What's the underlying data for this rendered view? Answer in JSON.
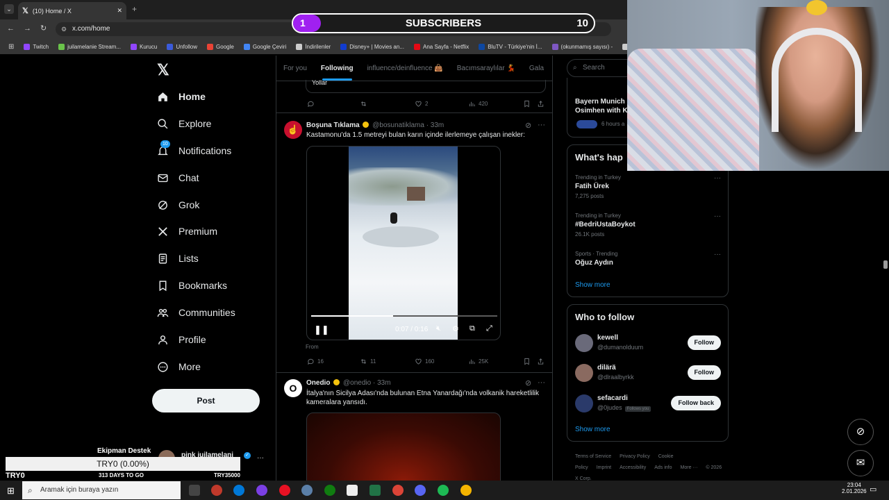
{
  "browser": {
    "tab_title": "(10) Home / X",
    "url": "x.com/home",
    "bookmarks": [
      {
        "label": "Twitch",
        "color": "#9146ff"
      },
      {
        "label": "juilamelanie Stream...",
        "color": "#6ac34a"
      },
      {
        "label": "Kurucu",
        "color": "#9146ff"
      },
      {
        "label": "Unfollow",
        "color": "#3b5bdb"
      },
      {
        "label": "Google",
        "color": "#ea4335"
      },
      {
        "label": "Google Çeviri",
        "color": "#4285f4"
      },
      {
        "label": "İndirilenler",
        "color": "#cccccc"
      },
      {
        "label": "Disney+ | Movies an...",
        "color": "#113ccf"
      },
      {
        "label": "Ana Sayfa - Netflix",
        "color": "#e50914"
      },
      {
        "label": "BluTV - Türkiye'nin İ...",
        "color": "#0d47a1"
      },
      {
        "label": "(okunmamış sayısı) -",
        "color": "#7e57c2"
      },
      {
        "label": "ju",
        "color": "#cccccc"
      }
    ]
  },
  "overlay": {
    "sub_count_left": "1",
    "sub_title": "SUBSCRIBERS",
    "sub_count_right": "10",
    "donation_name": "Ekipman Destek",
    "donation_progress": "TRY0 (0.00%)",
    "donation_progress_fraction": 0,
    "donation_start": "TRY0",
    "donation_days": "313 DAYS TO GO",
    "donation_goal": "TRY35000"
  },
  "nav": {
    "items": [
      {
        "label": "Home",
        "icon": "home-icon"
      },
      {
        "label": "Explore",
        "icon": "search-icon"
      },
      {
        "label": "Notifications",
        "icon": "bell-icon",
        "badge": "10"
      },
      {
        "label": "Chat",
        "icon": "mail-icon"
      },
      {
        "label": "Grok",
        "icon": "grok-icon"
      },
      {
        "label": "Premium",
        "icon": "x-icon"
      },
      {
        "label": "Lists",
        "icon": "list-icon"
      },
      {
        "label": "Bookmarks",
        "icon": "bookmark-icon"
      },
      {
        "label": "Communities",
        "icon": "people-icon"
      },
      {
        "label": "Profile",
        "icon": "person-icon"
      },
      {
        "label": "More",
        "icon": "more-icon"
      }
    ],
    "post_label": "Post",
    "account_name": "pink juilamelani",
    "account_more": "···"
  },
  "feed": {
    "tabs": [
      "For you",
      "Following",
      "influence/deinfluence 👜",
      "Bacımsaraylılar 💃",
      "Gala"
    ],
    "active_tab": "Following",
    "prev_tweet": {
      "tail_text": "Yollar",
      "replies": "",
      "likes": "2",
      "views": "420"
    },
    "tweet1": {
      "name": "Boşuna Tıklama",
      "handle": "@bosunatiklama",
      "time": "· 33m",
      "text": "Kastamonu'da 1.5 metreyi bulan karın içinde ilerlemeye çalışan inekler:",
      "video_time": "0:07 / 0:16",
      "video_progress_fraction": 0.44,
      "from_label": "From",
      "replies": "16",
      "reposts": "11",
      "likes": "160",
      "views": "25K"
    },
    "tweet2": {
      "name": "Onedio",
      "handle": "@onedio",
      "time": "· 33m",
      "text": "İtalya'nın Sicilya Adası'nda bulunan Etna Yanardağı'nda volkanik hareketlilik kameralara yansıdı."
    }
  },
  "sidebar": {
    "search_placeholder": "Search",
    "news_title": "Bayern Munich",
    "news_title2": "Osimhen with K",
    "news_time": "6 hours a",
    "whats_happening": "What's hap",
    "trends": [
      {
        "context": "Trending in Turkey",
        "name": "Fatih Ürek",
        "posts": "7,275 posts"
      },
      {
        "context": "Trending in Turkey",
        "name": "#BedriUstaBoykot",
        "posts": "26.1K posts"
      },
      {
        "context": "Sports · Trending",
        "name": "Oğuz Aydın",
        "posts": ""
      }
    ],
    "show_more": "Show more",
    "who_to_follow": "Who to follow",
    "follow_suggestions": [
      {
        "name": "kewell",
        "handle": "@dumanolduum",
        "button": "Follow",
        "follows_you": ""
      },
      {
        "name": "dilärä",
        "handle": "@dlraalbyrkk",
        "button": "Follow",
        "follows_you": ""
      },
      {
        "name": "sefacardi",
        "handle": "@0judes",
        "button": "Follow back",
        "follows_you": "Follows you"
      }
    ],
    "show_more2": "Show more",
    "footer": [
      "Terms of Service",
      "Privacy Policy",
      "Cookie Policy",
      "Imprint",
      "Accessibility",
      "Ads info",
      "More ···",
      "© 2026 X Corp."
    ]
  },
  "taskbar": {
    "search_placeholder": "Aramak için buraya yazın",
    "time": "23:04",
    "date": "2.01.2026"
  }
}
